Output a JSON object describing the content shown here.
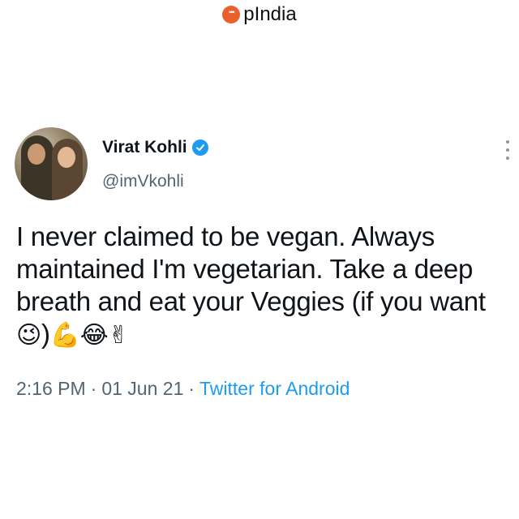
{
  "watermark": {
    "text": "pIndia"
  },
  "author": {
    "name": "Virat Kohli",
    "handle": "@imVkohli"
  },
  "tweet": {
    "text": "I never claimed to be vegan. Always maintained I'm vegetarian. Take a deep breath and eat your Veggies (if you want ",
    "emoji_wink": "😉",
    "close_paren": ")",
    "emoji_rest": "💪😂✌"
  },
  "meta": {
    "time": "2:16 PM",
    "sep1": "·",
    "date": "01 Jun 21",
    "sep2": "·",
    "source": "Twitter for Android"
  },
  "colors": {
    "link": "#1d9bf0",
    "muted": "#536471",
    "brand": "#e8602c"
  },
  "icons": [
    "opindia-logo-icon",
    "verified-badge-icon",
    "more-options-icon"
  ]
}
